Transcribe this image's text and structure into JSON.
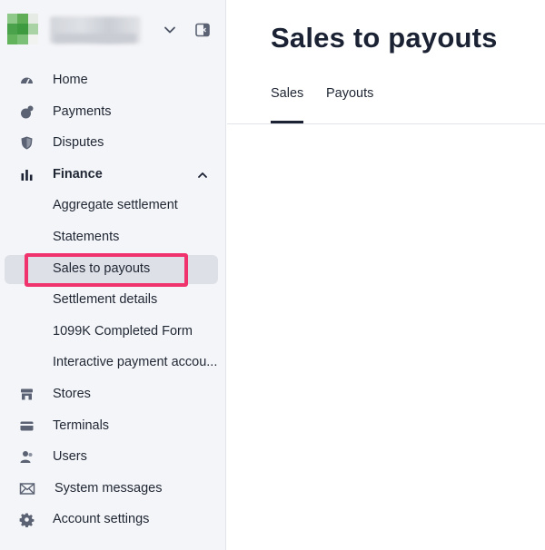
{
  "sidebar": {
    "items": [
      {
        "label": "Home",
        "icon": "gauge-icon"
      },
      {
        "label": "Payments",
        "icon": "coins-icon"
      },
      {
        "label": "Disputes",
        "icon": "shield-icon"
      },
      {
        "label": "Finance",
        "icon": "bar-chart-icon",
        "expanded": true
      },
      {
        "label": "Aggregate settlement"
      },
      {
        "label": "Statements"
      },
      {
        "label": "Sales to payouts",
        "selected": true
      },
      {
        "label": "Settlement details"
      },
      {
        "label": "1099K Completed Form"
      },
      {
        "label": "Interactive payment accou..."
      },
      {
        "label": "Stores",
        "icon": "store-icon"
      },
      {
        "label": "Terminals",
        "icon": "card-icon"
      },
      {
        "label": "Users",
        "icon": "users-icon"
      },
      {
        "label": "System messages",
        "icon": "mail-icon"
      },
      {
        "label": "Account settings",
        "icon": "gear-icon"
      }
    ]
  },
  "main": {
    "title": "Sales to payouts",
    "tabs": [
      {
        "label": "Sales",
        "active": true
      },
      {
        "label": "Payouts"
      }
    ]
  },
  "colors": {
    "highlight": "#f0336c",
    "selected_bg": "#dde0e6",
    "sidebar_bg": "#f4f5f8",
    "avatar_green": "#4aa34a"
  }
}
